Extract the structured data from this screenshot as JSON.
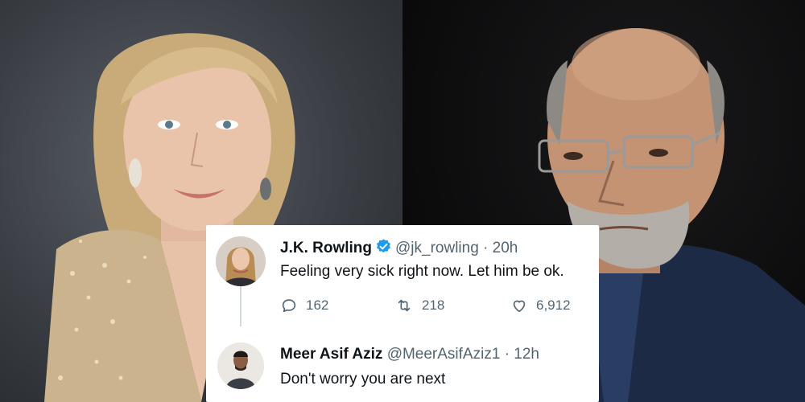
{
  "image": {
    "left_photo": "portrait-woman-blonde-sequin-dress",
    "right_photo": "portrait-man-glasses-beard-dark-suit"
  },
  "tweet": {
    "author_name": "J.K. Rowling",
    "handle": "@jk_rowling",
    "separator": "·",
    "time": "20h",
    "text": "Feeling very sick right now. Let him be ok.",
    "reply_count": "162",
    "retweet_count": "218",
    "like_count": "6,912"
  },
  "reply": {
    "author_name": "Meer Asif Aziz",
    "handle": "@MeerAsifAziz1",
    "separator": "·",
    "time": "12h",
    "text": "Don't worry you are next"
  },
  "colors": {
    "verified_blue": "#1d9bf0",
    "muted_text": "#536471",
    "primary_text": "#0f1419"
  }
}
